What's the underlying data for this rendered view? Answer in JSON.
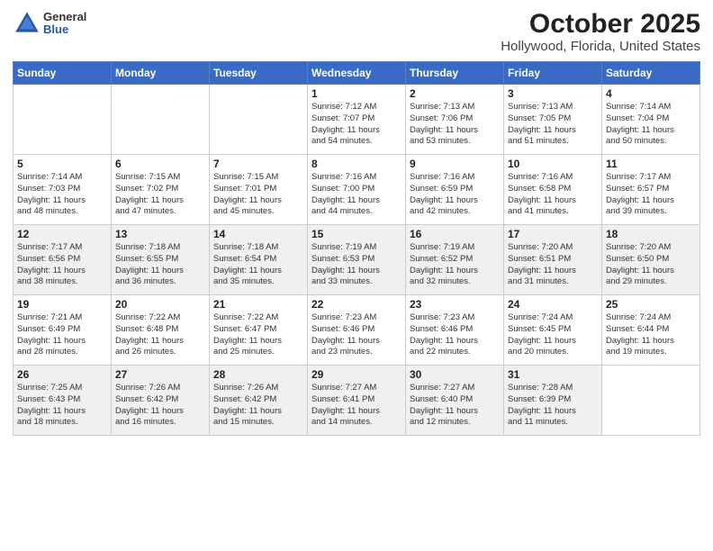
{
  "header": {
    "logo_general": "General",
    "logo_blue": "Blue",
    "title": "October 2025",
    "subtitle": "Hollywood, Florida, United States"
  },
  "calendar": {
    "days_of_week": [
      "Sunday",
      "Monday",
      "Tuesday",
      "Wednesday",
      "Thursday",
      "Friday",
      "Saturday"
    ],
    "weeks": [
      [
        {
          "day": "",
          "info": ""
        },
        {
          "day": "",
          "info": ""
        },
        {
          "day": "",
          "info": ""
        },
        {
          "day": "1",
          "info": "Sunrise: 7:12 AM\nSunset: 7:07 PM\nDaylight: 11 hours\nand 54 minutes."
        },
        {
          "day": "2",
          "info": "Sunrise: 7:13 AM\nSunset: 7:06 PM\nDaylight: 11 hours\nand 53 minutes."
        },
        {
          "day": "3",
          "info": "Sunrise: 7:13 AM\nSunset: 7:05 PM\nDaylight: 11 hours\nand 51 minutes."
        },
        {
          "day": "4",
          "info": "Sunrise: 7:14 AM\nSunset: 7:04 PM\nDaylight: 11 hours\nand 50 minutes."
        }
      ],
      [
        {
          "day": "5",
          "info": "Sunrise: 7:14 AM\nSunset: 7:03 PM\nDaylight: 11 hours\nand 48 minutes."
        },
        {
          "day": "6",
          "info": "Sunrise: 7:15 AM\nSunset: 7:02 PM\nDaylight: 11 hours\nand 47 minutes."
        },
        {
          "day": "7",
          "info": "Sunrise: 7:15 AM\nSunset: 7:01 PM\nDaylight: 11 hours\nand 45 minutes."
        },
        {
          "day": "8",
          "info": "Sunrise: 7:16 AM\nSunset: 7:00 PM\nDaylight: 11 hours\nand 44 minutes."
        },
        {
          "day": "9",
          "info": "Sunrise: 7:16 AM\nSunset: 6:59 PM\nDaylight: 11 hours\nand 42 minutes."
        },
        {
          "day": "10",
          "info": "Sunrise: 7:16 AM\nSunset: 6:58 PM\nDaylight: 11 hours\nand 41 minutes."
        },
        {
          "day": "11",
          "info": "Sunrise: 7:17 AM\nSunset: 6:57 PM\nDaylight: 11 hours\nand 39 minutes."
        }
      ],
      [
        {
          "day": "12",
          "info": "Sunrise: 7:17 AM\nSunset: 6:56 PM\nDaylight: 11 hours\nand 38 minutes."
        },
        {
          "day": "13",
          "info": "Sunrise: 7:18 AM\nSunset: 6:55 PM\nDaylight: 11 hours\nand 36 minutes."
        },
        {
          "day": "14",
          "info": "Sunrise: 7:18 AM\nSunset: 6:54 PM\nDaylight: 11 hours\nand 35 minutes."
        },
        {
          "day": "15",
          "info": "Sunrise: 7:19 AM\nSunset: 6:53 PM\nDaylight: 11 hours\nand 33 minutes."
        },
        {
          "day": "16",
          "info": "Sunrise: 7:19 AM\nSunset: 6:52 PM\nDaylight: 11 hours\nand 32 minutes."
        },
        {
          "day": "17",
          "info": "Sunrise: 7:20 AM\nSunset: 6:51 PM\nDaylight: 11 hours\nand 31 minutes."
        },
        {
          "day": "18",
          "info": "Sunrise: 7:20 AM\nSunset: 6:50 PM\nDaylight: 11 hours\nand 29 minutes."
        }
      ],
      [
        {
          "day": "19",
          "info": "Sunrise: 7:21 AM\nSunset: 6:49 PM\nDaylight: 11 hours\nand 28 minutes."
        },
        {
          "day": "20",
          "info": "Sunrise: 7:22 AM\nSunset: 6:48 PM\nDaylight: 11 hours\nand 26 minutes."
        },
        {
          "day": "21",
          "info": "Sunrise: 7:22 AM\nSunset: 6:47 PM\nDaylight: 11 hours\nand 25 minutes."
        },
        {
          "day": "22",
          "info": "Sunrise: 7:23 AM\nSunset: 6:46 PM\nDaylight: 11 hours\nand 23 minutes."
        },
        {
          "day": "23",
          "info": "Sunrise: 7:23 AM\nSunset: 6:46 PM\nDaylight: 11 hours\nand 22 minutes."
        },
        {
          "day": "24",
          "info": "Sunrise: 7:24 AM\nSunset: 6:45 PM\nDaylight: 11 hours\nand 20 minutes."
        },
        {
          "day": "25",
          "info": "Sunrise: 7:24 AM\nSunset: 6:44 PM\nDaylight: 11 hours\nand 19 minutes."
        }
      ],
      [
        {
          "day": "26",
          "info": "Sunrise: 7:25 AM\nSunset: 6:43 PM\nDaylight: 11 hours\nand 18 minutes."
        },
        {
          "day": "27",
          "info": "Sunrise: 7:26 AM\nSunset: 6:42 PM\nDaylight: 11 hours\nand 16 minutes."
        },
        {
          "day": "28",
          "info": "Sunrise: 7:26 AM\nSunset: 6:42 PM\nDaylight: 11 hours\nand 15 minutes."
        },
        {
          "day": "29",
          "info": "Sunrise: 7:27 AM\nSunset: 6:41 PM\nDaylight: 11 hours\nand 14 minutes."
        },
        {
          "day": "30",
          "info": "Sunrise: 7:27 AM\nSunset: 6:40 PM\nDaylight: 11 hours\nand 12 minutes."
        },
        {
          "day": "31",
          "info": "Sunrise: 7:28 AM\nSunset: 6:39 PM\nDaylight: 11 hours\nand 11 minutes."
        },
        {
          "day": "",
          "info": ""
        }
      ]
    ]
  }
}
